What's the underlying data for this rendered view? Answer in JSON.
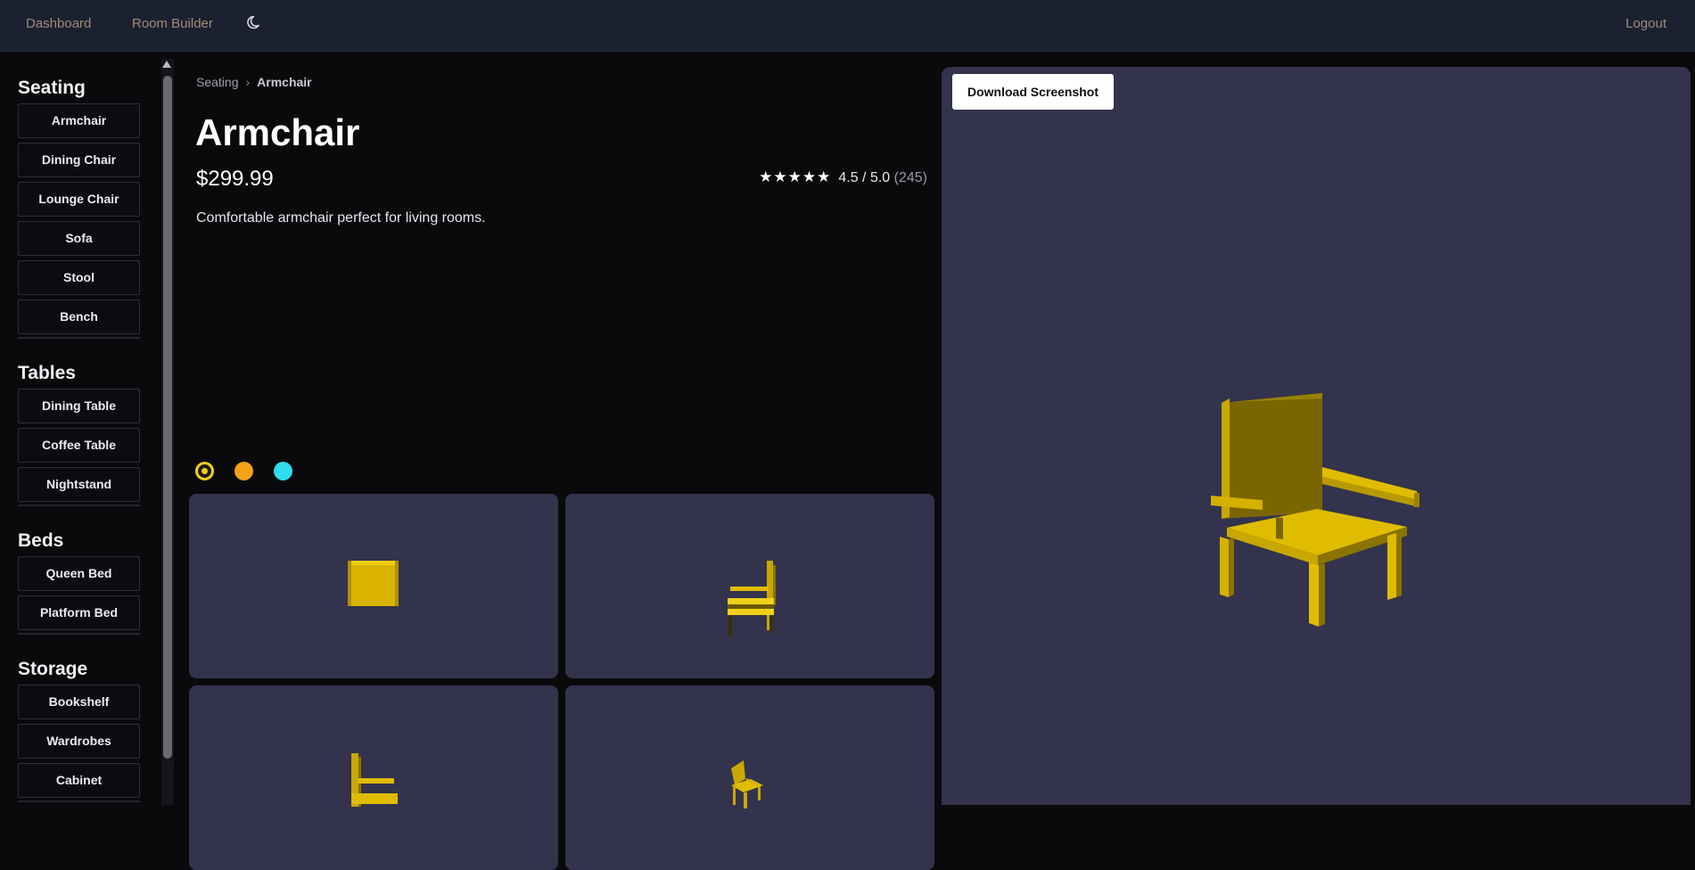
{
  "nav": {
    "dashboard": "Dashboard",
    "room_builder": "Room Builder",
    "theme_icon": "moon-icon",
    "logout": "Logout"
  },
  "sidebar": {
    "categories": [
      {
        "title": "Seating",
        "items": [
          "Armchair",
          "Dining Chair",
          "Lounge Chair",
          "Sofa",
          "Stool",
          "Bench"
        ]
      },
      {
        "title": "Tables",
        "items": [
          "Dining Table",
          "Coffee Table",
          "Nightstand"
        ]
      },
      {
        "title": "Beds",
        "items": [
          "Queen Bed",
          "Platform Bed"
        ]
      },
      {
        "title": "Storage",
        "items": [
          "Bookshelf",
          "Wardrobes",
          "Cabinet"
        ]
      }
    ]
  },
  "breadcrumb": {
    "parent": "Seating",
    "current": "Armchair"
  },
  "product": {
    "title": "Armchair",
    "price": "$299.99",
    "rating_stars": "★★★★★",
    "rating_text": "4.5 / 5.0",
    "rating_count": "(245)",
    "rating_value": 4.5,
    "description": "Comfortable armchair perfect for living rooms."
  },
  "colors": {
    "options": [
      "#f3cf1a",
      "#f5a316",
      "#2fdcf0"
    ],
    "selected": "#f3cf1a",
    "model": "#e0b800",
    "viewer_bg": "#33334d"
  },
  "viewer": {
    "download_label": "Download Screenshot"
  }
}
